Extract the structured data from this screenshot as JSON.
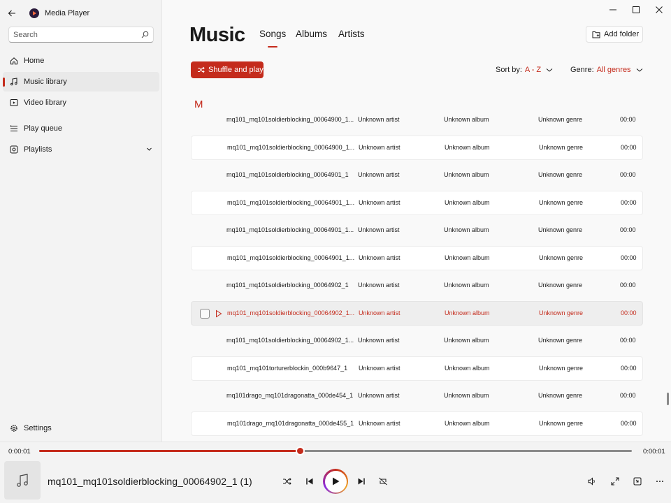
{
  "app": {
    "title": "Media Player"
  },
  "search": {
    "placeholder": "Search"
  },
  "sidebar": {
    "items": [
      {
        "label": "Home",
        "icon": "home-icon"
      },
      {
        "label": "Music library",
        "icon": "music-note-icon",
        "active": true
      },
      {
        "label": "Video library",
        "icon": "video-icon"
      },
      {
        "label": "Play queue",
        "icon": "queue-icon"
      },
      {
        "label": "Playlists",
        "icon": "playlist-icon"
      }
    ],
    "settings_label": "Settings"
  },
  "header": {
    "title": "Music",
    "tabs": [
      "Songs",
      "Albums",
      "Artists"
    ],
    "active_tab": "Songs",
    "add_folder_label": "Add folder"
  },
  "toolbar": {
    "shuffle_label": "Shuffle and play",
    "sort_label": "Sort by:",
    "sort_value": "A - Z",
    "genre_label": "Genre:",
    "genre_value": "All genres"
  },
  "section_letter": "M",
  "songs": [
    {
      "title": "mq101_mq101soldierblocking_00064900_1...",
      "artist": "Unknown artist",
      "album": "Unknown album",
      "genre": "Unknown genre",
      "duration": "00:00"
    },
    {
      "title": "mq101_mq101soldierblocking_00064900_1...",
      "artist": "Unknown artist",
      "album": "Unknown album",
      "genre": "Unknown genre",
      "duration": "00:00"
    },
    {
      "title": "mq101_mq101soldierblocking_00064901_1",
      "artist": "Unknown artist",
      "album": "Unknown album",
      "genre": "Unknown genre",
      "duration": "00:00"
    },
    {
      "title": "mq101_mq101soldierblocking_00064901_1...",
      "artist": "Unknown artist",
      "album": "Unknown album",
      "genre": "Unknown genre",
      "duration": "00:00"
    },
    {
      "title": "mq101_mq101soldierblocking_00064901_1...",
      "artist": "Unknown artist",
      "album": "Unknown album",
      "genre": "Unknown genre",
      "duration": "00:00"
    },
    {
      "title": "mq101_mq101soldierblocking_00064901_1...",
      "artist": "Unknown artist",
      "album": "Unknown album",
      "genre": "Unknown genre",
      "duration": "00:00"
    },
    {
      "title": "mq101_mq101soldierblocking_00064902_1",
      "artist": "Unknown artist",
      "album": "Unknown album",
      "genre": "Unknown genre",
      "duration": "00:00"
    },
    {
      "title": "mq101_mq101soldierblocking_00064902_1...",
      "artist": "Unknown artist",
      "album": "Unknown album",
      "genre": "Unknown genre",
      "duration": "00:00",
      "selected": true
    },
    {
      "title": "mq101_mq101soldierblocking_00064902_1...",
      "artist": "Unknown artist",
      "album": "Unknown album",
      "genre": "Unknown genre",
      "duration": "00:00"
    },
    {
      "title": "mq101_mq101torturerblockin_000b9647_1",
      "artist": "Unknown artist",
      "album": "Unknown album",
      "genre": "Unknown genre",
      "duration": "00:00"
    },
    {
      "title": "mq101drago_mq101dragonatta_000de454_1",
      "artist": "Unknown artist",
      "album": "Unknown album",
      "genre": "Unknown genre",
      "duration": "00:00"
    },
    {
      "title": "mq101drago_mq101dragonatta_000de455_1",
      "artist": "Unknown artist",
      "album": "Unknown album",
      "genre": "Unknown genre",
      "duration": "00:00"
    }
  ],
  "player": {
    "elapsed": "0:00:01",
    "total": "0:00:01",
    "progress_fraction": 0.44,
    "now_playing": "mq101_mq101soldierblocking_00064902_1 (1)"
  },
  "colors": {
    "accent": "#c42b1c"
  }
}
